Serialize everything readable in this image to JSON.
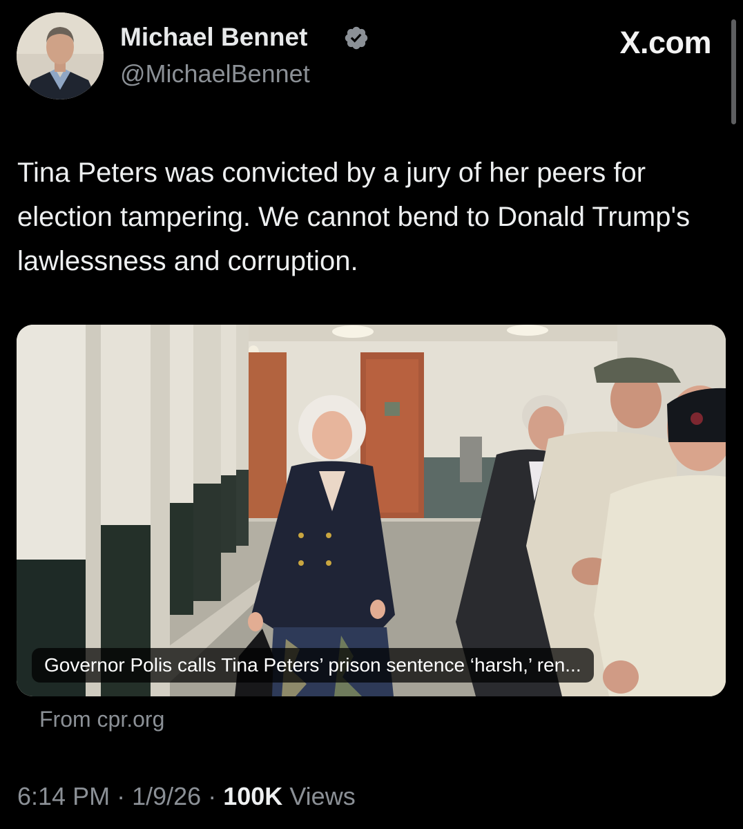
{
  "author": {
    "name": "Michael Bennet",
    "handle": "@MichaelBennet",
    "verified": true
  },
  "brand": "X.com",
  "tweet_text": "Tina Peters was convicted by a jury of her peers for election tampering. We cannot bend to Donald Trump's lawlessness and corruption.",
  "card": {
    "headline": "Governor Polis calls Tina Peters’ prison sentence ‘harsh,’ ren...",
    "source": "From cpr.org"
  },
  "meta": {
    "time": "6:14 PM",
    "separator": "·",
    "date": "1/9/26",
    "views_count": "100K",
    "views_label": "Views"
  },
  "colors": {
    "background": "#000000",
    "text_primary": "#e7e9ea",
    "text_secondary": "#8b9096",
    "verified_badge": "#8b9096"
  },
  "icons": {
    "verified": "verified-badge-icon",
    "avatar": "profile-photo"
  }
}
